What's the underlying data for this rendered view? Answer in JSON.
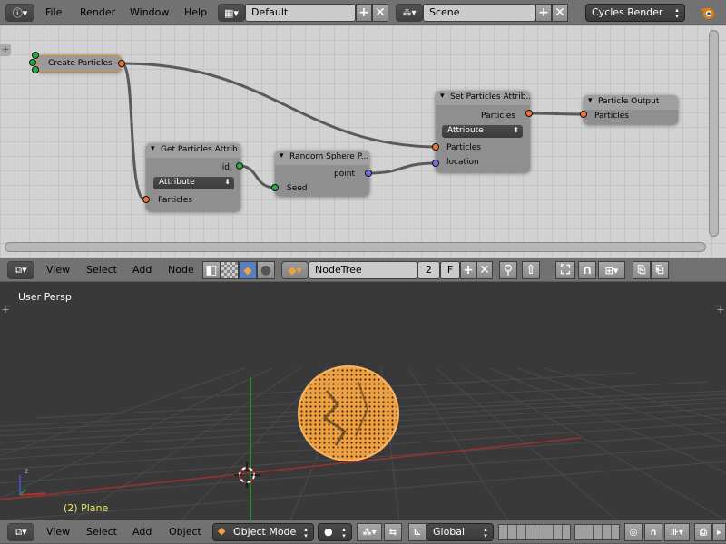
{
  "top_bar": {
    "menus": [
      "File",
      "Render",
      "Window",
      "Help"
    ],
    "layout": "Default",
    "scene": "Scene",
    "engine": "Cycles Render"
  },
  "node_editor": {
    "nodes": {
      "create_particles": {
        "title": "Create Particles"
      },
      "get_particles": {
        "title": "Get Particles Attrib...",
        "out_id": "id",
        "dropdown": "Attribute",
        "in_particles": "Particles"
      },
      "random_sphere": {
        "title": "Random Sphere P...",
        "out_point": "point",
        "in_seed": "Seed"
      },
      "set_particles": {
        "title": "Set Particles Attrib...",
        "out_particles": "Particles",
        "dropdown": "Attribute",
        "in_particles": "Particles",
        "in_location": "location"
      },
      "particle_output": {
        "title": "Particle Output",
        "in_particles": "Particles"
      }
    }
  },
  "node_header": {
    "menus": [
      "View",
      "Select",
      "Add",
      "Node"
    ],
    "tree_name": "NodeTree",
    "users": "2",
    "fake_user": "F"
  },
  "viewport": {
    "view_label": "User Persp",
    "object_label": "(2) Plane"
  },
  "viewport_header": {
    "menus": [
      "View",
      "Select",
      "Add",
      "Object"
    ],
    "mode": "Object Mode",
    "orientation": "Global"
  },
  "colors": {
    "particles": "#f0a040",
    "x_axis": "#9c3030",
    "y_axis": "#3a9a3a",
    "socket_orange": "#e9753c",
    "socket_green": "#2fa84a",
    "socket_blue": "#6f6fe8"
  }
}
